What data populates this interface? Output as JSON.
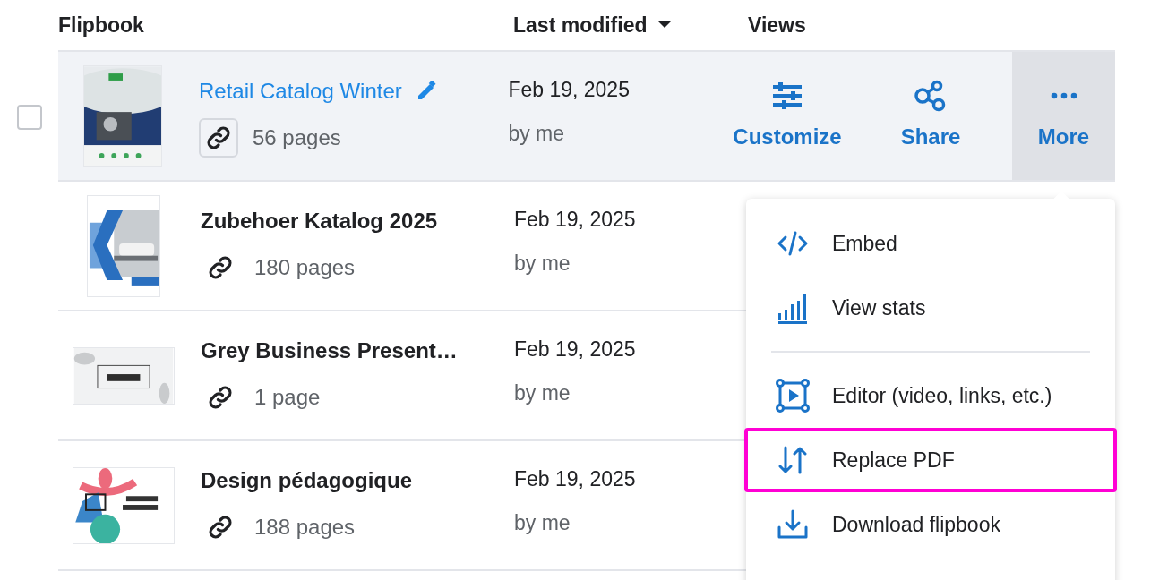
{
  "columns": [
    {
      "label": "Flipbook",
      "sortable": false
    },
    {
      "label": "Last modified",
      "sortable": true
    },
    {
      "label": "Views",
      "sortable": false
    }
  ],
  "rows": [
    {
      "title": "Retail Catalog Winter",
      "pages": "56 pages",
      "date": "Feb 19, 2025",
      "owner": "by me",
      "highlighted": true,
      "checked": false
    },
    {
      "title": "Zubehoer Katalog 2025",
      "pages": "180 pages",
      "date": "Feb 19, 2025",
      "owner": "by me",
      "highlighted": false
    },
    {
      "title": "Grey Business Present…",
      "pages": "1 page",
      "date": "Feb 19, 2025",
      "owner": "by me",
      "highlighted": false
    },
    {
      "title": "Design pédagogique",
      "pages": "188 pages",
      "date": "Feb 19, 2025",
      "owner": "by me",
      "highlighted": false
    }
  ],
  "row_actions": [
    {
      "label": "Customize",
      "kind": "customize",
      "active": false
    },
    {
      "label": "Share",
      "kind": "share",
      "active": false
    },
    {
      "label": "More",
      "kind": "more",
      "active": true
    }
  ],
  "menu": {
    "items": [
      {
        "label": "Embed",
        "kind": "embed",
        "highlighted": false
      },
      {
        "label": "View stats",
        "kind": "stats",
        "highlighted": false
      },
      {
        "kind": "divider"
      },
      {
        "label": "Editor (video, links, etc.)",
        "kind": "editor",
        "highlighted": false
      },
      {
        "label": "Replace PDF",
        "kind": "replace",
        "highlighted": true
      },
      {
        "label": "Download flipbook",
        "kind": "download",
        "highlighted": false
      }
    ]
  }
}
